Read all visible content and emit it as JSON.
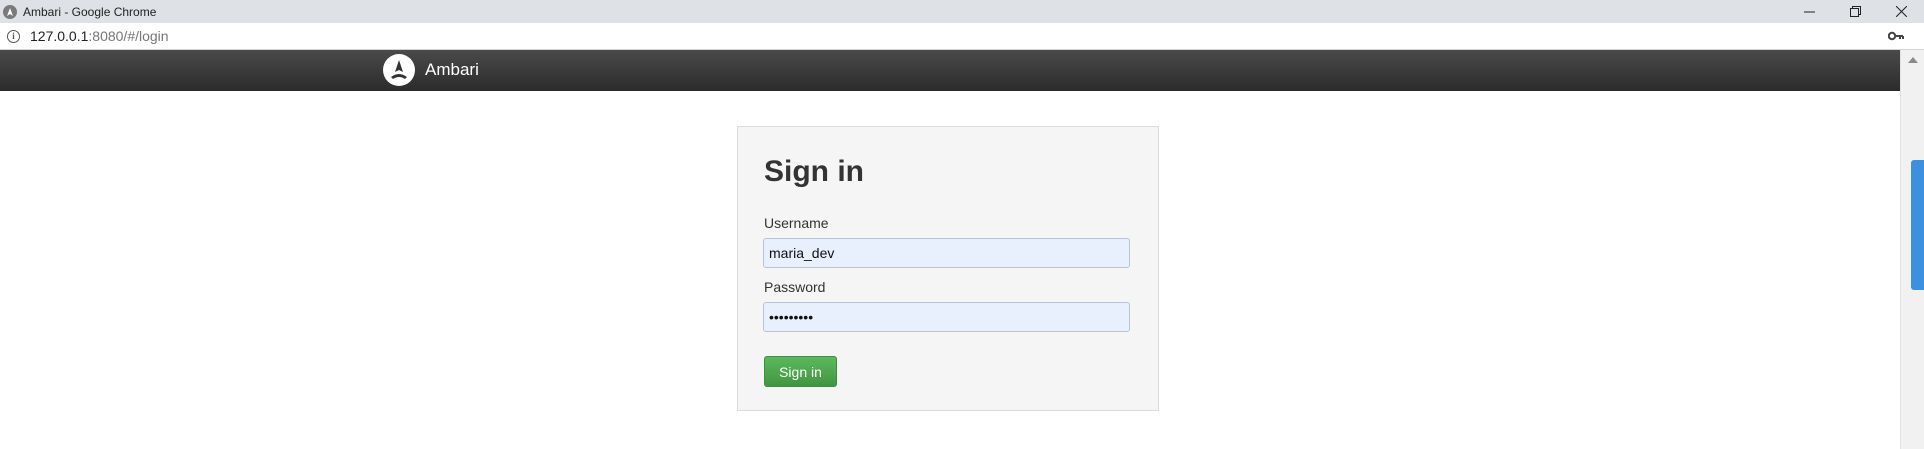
{
  "window": {
    "title": "Ambari - Google Chrome",
    "controls": {
      "minimize_icon": "minimize-icon",
      "restore_icon": "restore-icon",
      "close_icon": "close-icon"
    }
  },
  "address_bar": {
    "host": "127.0.0.1",
    "path": ":8080/#/login"
  },
  "app": {
    "name": "Ambari",
    "navbar_color": "#333333"
  },
  "login": {
    "heading": "Sign in",
    "username_label": "Username",
    "username_value": "maria_dev",
    "password_label": "Password",
    "password_value": "maria_dev",
    "submit_label": "Sign in",
    "submit_color": "#4cae4c"
  }
}
